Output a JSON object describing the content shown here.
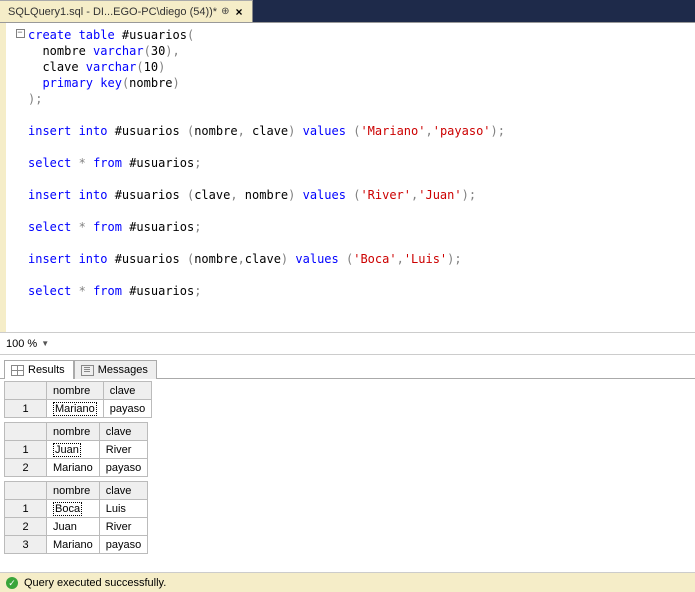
{
  "tab": {
    "title": "SQLQuery1.sql - DI...EGO-PC\\diego (54))*",
    "pinnable": true
  },
  "code": {
    "lines": [
      {
        "indent": 0,
        "tokens": [
          [
            "kw",
            "create table"
          ],
          [
            "plain",
            " #usuarios"
          ],
          [
            "op",
            "("
          ]
        ]
      },
      {
        "indent": 1,
        "tokens": [
          [
            "plain",
            "nombre "
          ],
          [
            "kw",
            "varchar"
          ],
          [
            "op",
            "("
          ],
          [
            "plain",
            "30"
          ],
          [
            "op",
            ")"
          ],
          [
            "op",
            ","
          ]
        ]
      },
      {
        "indent": 1,
        "tokens": [
          [
            "plain",
            "clave "
          ],
          [
            "kw",
            "varchar"
          ],
          [
            "op",
            "("
          ],
          [
            "plain",
            "10"
          ],
          [
            "op",
            ")"
          ]
        ]
      },
      {
        "indent": 1,
        "tokens": [
          [
            "kw",
            "primary key"
          ],
          [
            "op",
            "("
          ],
          [
            "plain",
            "nombre"
          ],
          [
            "op",
            ")"
          ]
        ]
      },
      {
        "indent": 0,
        "tokens": [
          [
            "op",
            ")"
          ],
          [
            "op",
            ";"
          ]
        ]
      },
      {
        "blank": true
      },
      {
        "indent": 0,
        "tokens": [
          [
            "kw",
            "insert into"
          ],
          [
            "plain",
            " #usuarios "
          ],
          [
            "op",
            "("
          ],
          [
            "plain",
            "nombre"
          ],
          [
            "op",
            ","
          ],
          [
            "plain",
            " clave"
          ],
          [
            "op",
            ")"
          ],
          [
            "plain",
            " "
          ],
          [
            "kw",
            "values"
          ],
          [
            "plain",
            " "
          ],
          [
            "op",
            "("
          ],
          [
            "str",
            "'Mariano'"
          ],
          [
            "op",
            ","
          ],
          [
            "str",
            "'payaso'"
          ],
          [
            "op",
            ")"
          ],
          [
            "op",
            ";"
          ]
        ]
      },
      {
        "blank": true
      },
      {
        "indent": 0,
        "tokens": [
          [
            "kw",
            "select"
          ],
          [
            "plain",
            " "
          ],
          [
            "op",
            "*"
          ],
          [
            "plain",
            " "
          ],
          [
            "kw",
            "from"
          ],
          [
            "plain",
            " #usuarios"
          ],
          [
            "op",
            ";"
          ]
        ]
      },
      {
        "blank": true
      },
      {
        "indent": 0,
        "tokens": [
          [
            "kw",
            "insert into"
          ],
          [
            "plain",
            " #usuarios "
          ],
          [
            "op",
            "("
          ],
          [
            "plain",
            "clave"
          ],
          [
            "op",
            ","
          ],
          [
            "plain",
            " nombre"
          ],
          [
            "op",
            ")"
          ],
          [
            "plain",
            " "
          ],
          [
            "kw",
            "values"
          ],
          [
            "plain",
            " "
          ],
          [
            "op",
            "("
          ],
          [
            "str",
            "'River'"
          ],
          [
            "op",
            ","
          ],
          [
            "str",
            "'Juan'"
          ],
          [
            "op",
            ")"
          ],
          [
            "op",
            ";"
          ]
        ]
      },
      {
        "blank": true
      },
      {
        "indent": 0,
        "tokens": [
          [
            "kw",
            "select"
          ],
          [
            "plain",
            " "
          ],
          [
            "op",
            "*"
          ],
          [
            "plain",
            " "
          ],
          [
            "kw",
            "from"
          ],
          [
            "plain",
            " #usuarios"
          ],
          [
            "op",
            ";"
          ]
        ]
      },
      {
        "blank": true
      },
      {
        "indent": 0,
        "tokens": [
          [
            "kw",
            "insert into"
          ],
          [
            "plain",
            " #usuarios "
          ],
          [
            "op",
            "("
          ],
          [
            "plain",
            "nombre"
          ],
          [
            "op",
            ","
          ],
          [
            "plain",
            "clave"
          ],
          [
            "op",
            ")"
          ],
          [
            "plain",
            " "
          ],
          [
            "kw",
            "values"
          ],
          [
            "plain",
            " "
          ],
          [
            "op",
            "("
          ],
          [
            "str",
            "'Boca'"
          ],
          [
            "op",
            ","
          ],
          [
            "str",
            "'Luis'"
          ],
          [
            "op",
            ")"
          ],
          [
            "op",
            ";"
          ]
        ]
      },
      {
        "blank": true
      },
      {
        "indent": 0,
        "tokens": [
          [
            "kw",
            "select"
          ],
          [
            "plain",
            " "
          ],
          [
            "op",
            "*"
          ],
          [
            "plain",
            " "
          ],
          [
            "kw",
            "from"
          ],
          [
            "plain",
            " #usuarios"
          ],
          [
            "op",
            ";"
          ]
        ]
      }
    ]
  },
  "zoom": {
    "value": "100 %"
  },
  "results_tabs": {
    "results": "Results",
    "messages": "Messages"
  },
  "grids": [
    {
      "columns": [
        "nombre",
        "clave"
      ],
      "rows": [
        {
          "n": "1",
          "cells": [
            "Mariano",
            "payaso"
          ],
          "selected": 0
        }
      ]
    },
    {
      "columns": [
        "nombre",
        "clave"
      ],
      "rows": [
        {
          "n": "1",
          "cells": [
            "Juan",
            "River"
          ],
          "selected": 0
        },
        {
          "n": "2",
          "cells": [
            "Mariano",
            "payaso"
          ]
        }
      ]
    },
    {
      "columns": [
        "nombre",
        "clave"
      ],
      "rows": [
        {
          "n": "1",
          "cells": [
            "Boca",
            "Luis"
          ],
          "selected": 0
        },
        {
          "n": "2",
          "cells": [
            "Juan",
            "River"
          ]
        },
        {
          "n": "3",
          "cells": [
            "Mariano",
            "payaso"
          ]
        }
      ]
    }
  ],
  "status": {
    "text": "Query executed successfully."
  }
}
